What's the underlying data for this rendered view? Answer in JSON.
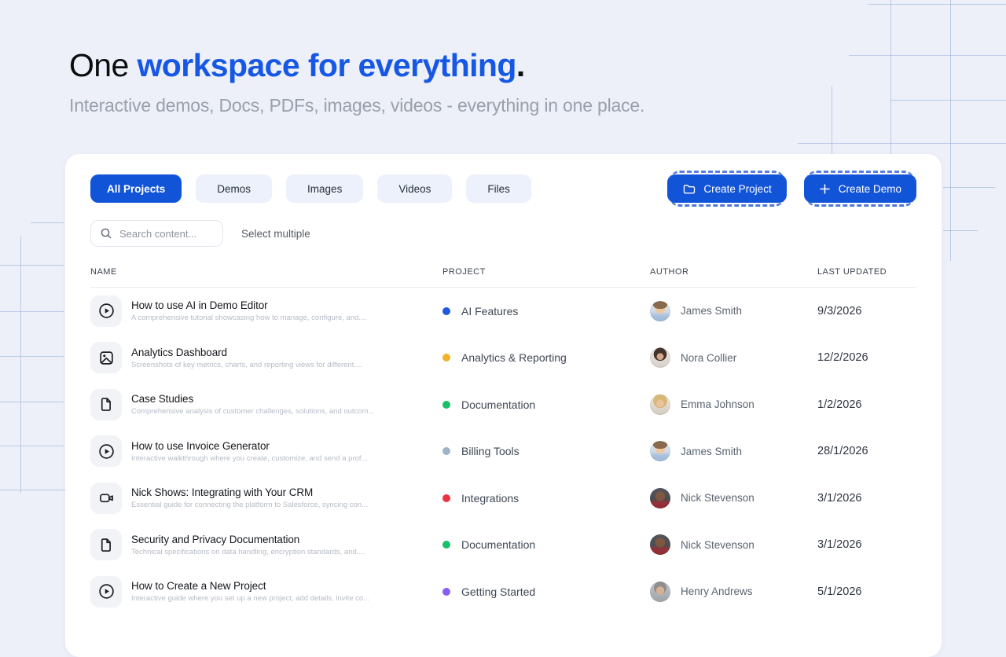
{
  "hero": {
    "title_prefix": "One ",
    "title_highlight": "workspace for everything",
    "title_suffix": ".",
    "subtitle": "Interactive demos, Docs, PDFs, images, videos - everything in one place."
  },
  "toolbar": {
    "filters": [
      {
        "label": "All Projects",
        "active": true
      },
      {
        "label": "Demos",
        "active": false
      },
      {
        "label": "Images",
        "active": false
      },
      {
        "label": "Videos",
        "active": false
      },
      {
        "label": "Files",
        "active": false
      }
    ],
    "create_project_label": "Create Project",
    "create_demo_label": "Create Demo"
  },
  "search": {
    "placeholder": "Search content...",
    "select_multiple_label": "Select multiple"
  },
  "table": {
    "columns": {
      "name": "NAME",
      "project": "PROJECT",
      "author": "AUTHOR",
      "last_updated": "LAST UPDATED"
    },
    "rows": [
      {
        "icon": "play-icon",
        "title": "How to use AI in Demo Editor",
        "description": "A comprehensive tutorial showcasing how to manage, configure, and....",
        "project": "AI Features",
        "project_color": "#1d59e0",
        "author": "James Smith",
        "last_updated": "9/3/2026"
      },
      {
        "icon": "image-icon",
        "title": "Analytics Dashboard",
        "description": "Screenshots of key metrics, charts, and reporting views for different....",
        "project": "Analytics & Reporting",
        "project_color": "#f3b229",
        "author": "Nora Collier",
        "last_updated": "12/2/2026"
      },
      {
        "icon": "file-icon",
        "title": "Case Studies",
        "description": "Comprehensive analysis of customer challenges, solutions, and outcom...",
        "project": "Documentation",
        "project_color": "#17c069",
        "author": "Emma Johnson",
        "last_updated": "1/2/2026"
      },
      {
        "icon": "play-icon",
        "title": "How to use Invoice Generator",
        "description": "Interactive walkthrough where you create, customize, and send a prof...",
        "project": "Billing Tools",
        "project_color": "#9eb4c6",
        "author": "James Smith",
        "last_updated": "28/1/2026"
      },
      {
        "icon": "video-icon",
        "title": "Nick Shows: Integrating with Your CRM",
        "description": "Essential guide for connecting the platform to Salesforce, syncing con...",
        "project": "Integrations",
        "project_color": "#ee3140",
        "author": "Nick Stevenson",
        "last_updated": "3/1/2026"
      },
      {
        "icon": "file-icon",
        "title": "Security and Privacy Documentation",
        "description": "Technical specifications on data handling, encryption standards, and....",
        "project": "Documentation",
        "project_color": "#17c069",
        "author": "Nick Stevenson",
        "last_updated": "3/1/2026"
      },
      {
        "icon": "play-icon",
        "title": "How to Create a New Project",
        "description": "Interactive guide where you set up a new project, add details, invite co...",
        "project": "Getting Started",
        "project_color": "#8a5cf5",
        "author": "Henry Andrews",
        "last_updated": "5/1/2026"
      }
    ]
  },
  "colors": {
    "accent_blue": "#1254d8",
    "heading_blue": "#1657e5",
    "page_background": "#edf0f8",
    "card_background": "#ffffff"
  }
}
